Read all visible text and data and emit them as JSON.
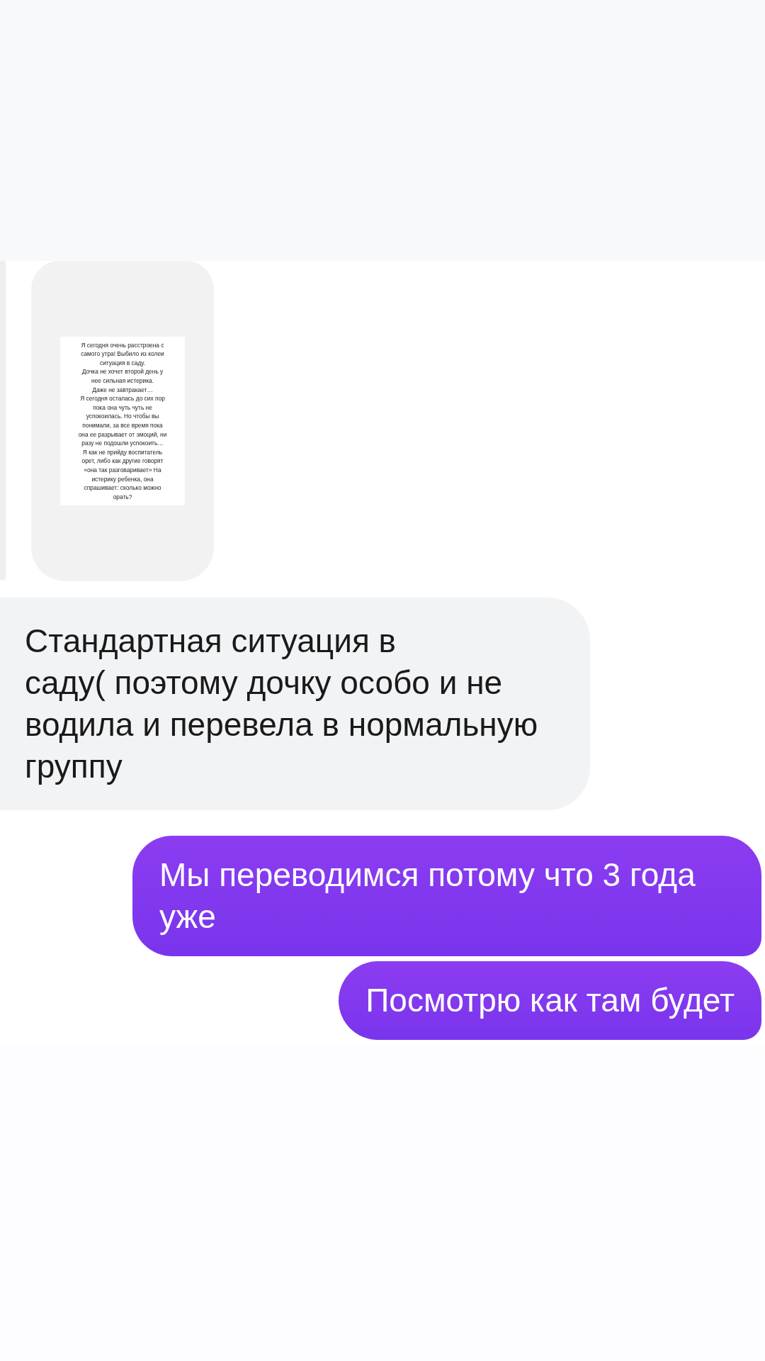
{
  "story": {
    "kind": "picture-text",
    "lines": [
      "Я сегодня очень расстроена с",
      "самого утра! Выбило из колеи",
      "ситуация в саду.",
      "Дочка не хочет второй день у",
      "нее сильная истерика.",
      "Даже не завтракает…",
      "Я сегодня осталась до сих пор",
      "пока она чуть чуть не",
      "успокоилась. Но чтобы вы",
      "понимали, за все время пока",
      "она ее разрывает от эмоций, ни",
      "разу не подошли успокоить…",
      "Я как не прийду воспитатель",
      "орет, либо как другие говорят",
      "«она так разговаривает» На",
      "истерику ребенка, она",
      "спрашивает: сколько можно",
      "орать?"
    ]
  },
  "messages": [
    {
      "kind": "incoming",
      "text": "Стандартная ситуация в\nсаду( поэтому дочку особо и не водила и перевела в нормальную группу"
    },
    {
      "kind": "outgoing",
      "text": "Мы переводимся потому что 3 года уже"
    },
    {
      "kind": "outgoing",
      "text": "Посмотрю как там будет"
    }
  ]
}
